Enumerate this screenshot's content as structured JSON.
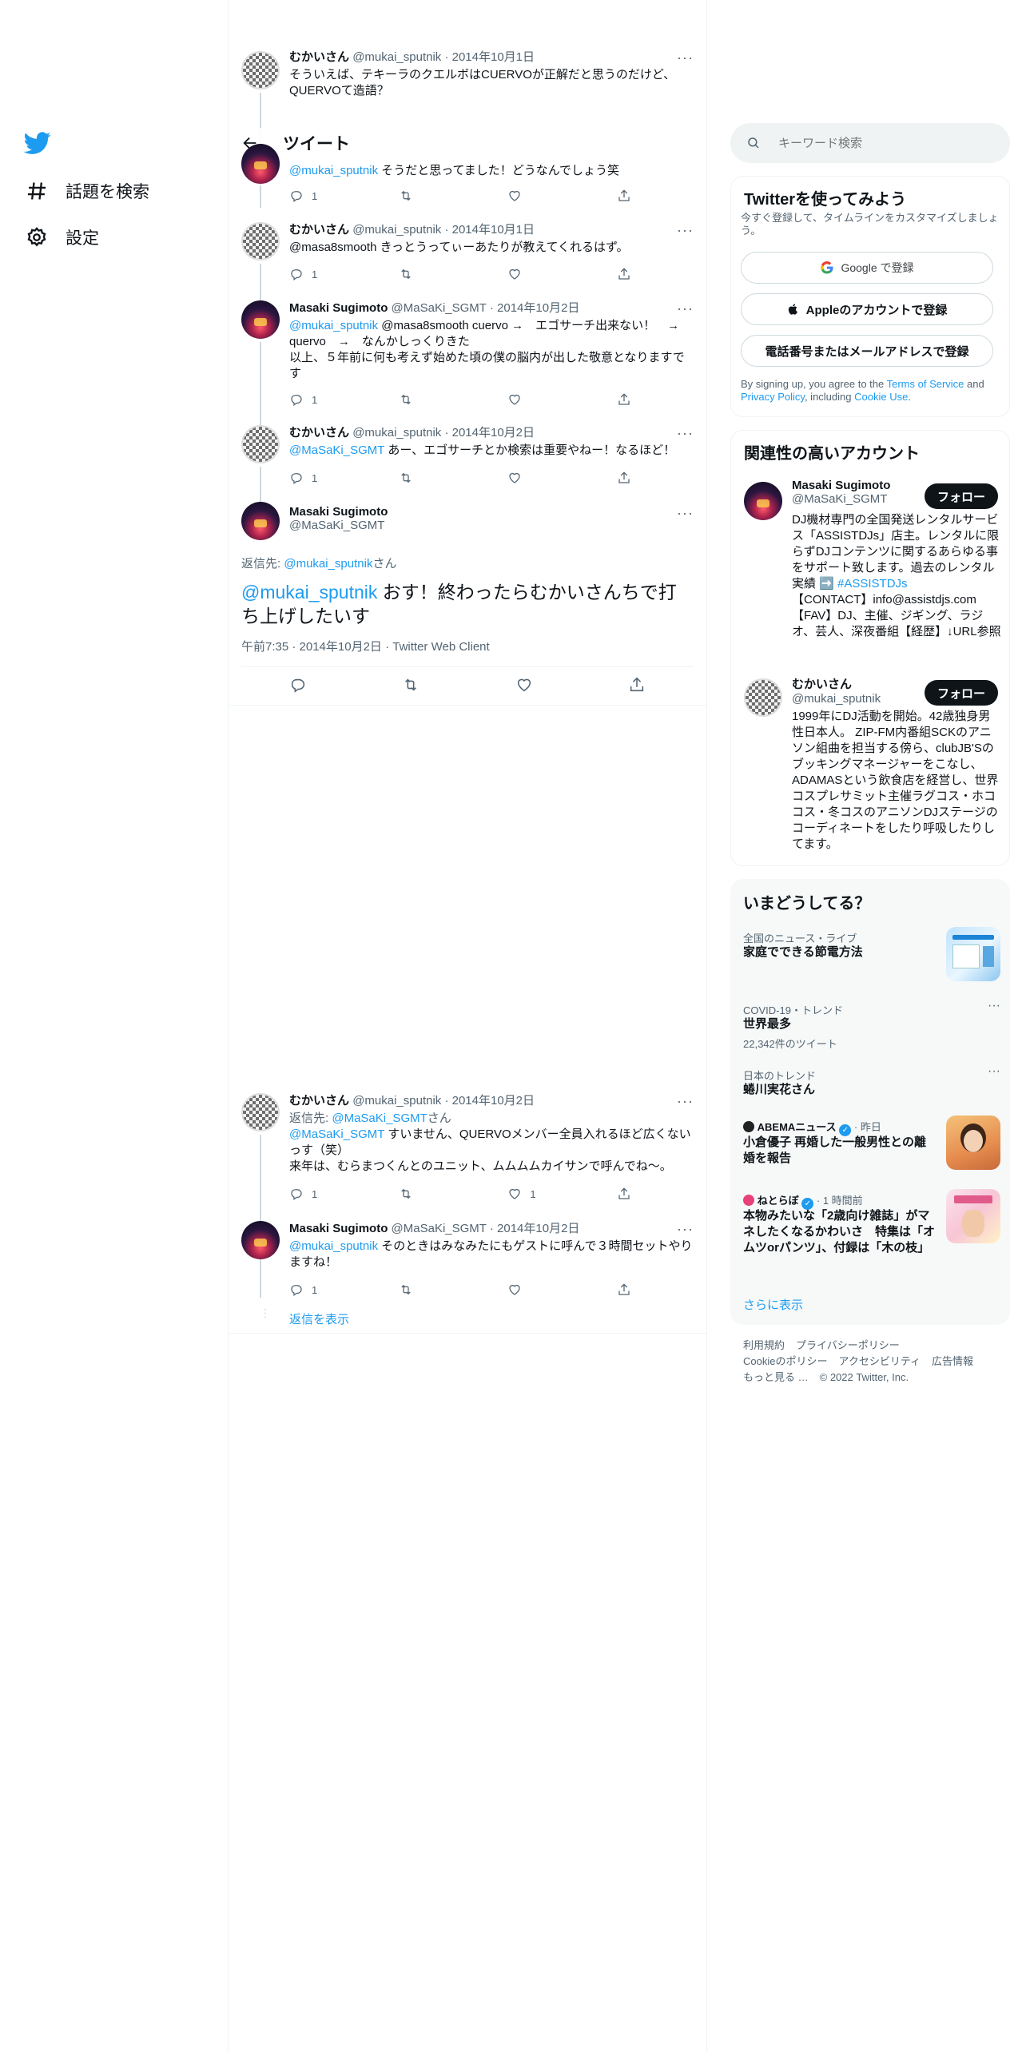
{
  "nav": {
    "explore_label": "話題を検索",
    "settings_label": "設定"
  },
  "header": {
    "title": "ツイート"
  },
  "thread_top": {
    "name": "むかいさん",
    "meta": "@mukai_sputnik · 2014年10月1日",
    "text": "そういえば、テキーラのクエルボはCUERVOが正解だと思うのだけど、QUERVOて造語？",
    "reply_count": "1"
  },
  "tweets": [
    {
      "name": "",
      "meta": "",
      "mention": "@mukai_sputnik",
      "text": " そうだと思ってました！どうなんでしょう笑",
      "reply_count": "1"
    },
    {
      "name": "むかいさん",
      "meta": "@mukai_sputnik · 2014年10月1日",
      "text": "@masa8smooth きっとうってぃーあたりが教えてくれるはず。",
      "reply_count": "1"
    },
    {
      "name": "Masaki Sugimoto",
      "meta": "@MaSaKi_SGMT · 2014年10月2日",
      "mention": "@mukai_sputnik",
      "text": " @masa8smooth cuervo →　エゴサーチ出来ない！　→ quervo　→　なんかしっくりきた\n以上、５年前に何も考えず始めた頃の僕の脳内が出した敬意となりますです",
      "reply_count": "1"
    },
    {
      "name": "むかいさん",
      "meta": "@mukai_sputnik · 2014年10月2日",
      "mention": "@MaSaKi_SGMT",
      "text": " あー、エゴサーチとか検索は重要やねー！なるほど！",
      "reply_count": "1"
    }
  ],
  "focus": {
    "name": "Masaki Sugimoto",
    "handle": "@MaSaKi_SGMT",
    "reply_prefix": "返信先: ",
    "reply_to": "@mukai_sputnik",
    "reply_suffix": "さん",
    "mention": "@mukai_sputnik",
    "text": " おす！終わったらむかいさんちで打ち上げしたいす",
    "meta": "午前7:35 · 2014年10月2日 · Twitter Web Client"
  },
  "replies": [
    {
      "name": "むかいさん",
      "meta": "@mukai_sputnik · 2014年10月2日",
      "reply_prefix": "返信先: ",
      "reply_to": "@MaSaKi_SGMT",
      "reply_suffix": "さん",
      "mention": "@MaSaKi_SGMT",
      "text": " すいません、QUERVOメンバー全員入れるほど広くないっす（笑）\n来年は、むらまつくんとのユニット、ムムムムカイサンで呼んでね〜。",
      "reply_count": "1",
      "like_count": "1"
    },
    {
      "name": "Masaki Sugimoto",
      "meta": "@MaSaKi_SGMT · 2014年10月2日",
      "mention": "@mukai_sputnik",
      "text": " そのときはみなみたにもゲストに呼んで３時間セットやりますね！",
      "reply_count": "1"
    }
  ],
  "show_replies": "返信を表示",
  "sidebar": {
    "search_placeholder": "キーワード検索",
    "signup": {
      "title": "Twitterを使ってみよう",
      "subtitle": "今すぐ登録して、タイムラインをカスタマイズしましょう。",
      "google": "Google で登録",
      "apple": "Appleのアカウントで登録",
      "phone": "電話番号またはメールアドレスで登録",
      "terms_prefix": "By signing up, you agree to the ",
      "terms_link": "Terms of Service",
      "terms_and": " and ",
      "privacy_link": "Privacy Policy",
      "terms_including": ", including ",
      "cookie_link": "Cookie Use",
      "terms_end": "."
    },
    "related": {
      "title": "関連性の高いアカウント",
      "follow_label": "フォロー",
      "accounts": [
        {
          "name": "Masaki Sugimoto",
          "handle": "@MaSaKi_SGMT",
          "bio": "DJ機材専門の全国発送レンタルサービス「ASSISTDJs」店主。レンタルに限らずDJコンテンツに関するあらゆる事をサポート致します。過去のレンタル実績 ➡️",
          "bio_tag": " #ASSISTDJs",
          "bio_rest": "【CONTACT】info@assistdjs.com 【FAV】DJ、主催、ジギング、ラジオ、芸人、深夜番組【経歴】↓URL参照"
        },
        {
          "name": "むかいさん",
          "handle": "@mukai_sputnik",
          "bio": "1999年にDJ活動を開始。42歳独身男性日本人。 ZIP-FM内番組SCKのアニソン組曲を担当する傍ら、clubJB'Sのブッキングマネージャーをこなし、ADAMASという飲食店を経営し、世界コスプレサミット主催ラグコス・ホココス・冬コスのアニソンDJステージのコーディネートをしたり呼吸したりしてます。"
        }
      ]
    },
    "trends": {
      "title": "いまどうしてる？",
      "items": [
        {
          "meta": "全国のニュース・ライブ",
          "title": "家庭でできる節電方法",
          "count": ""
        },
        {
          "meta": "COVID-19・トレンド",
          "title": "世界最多",
          "count": "22,342件のツイート"
        },
        {
          "meta": "日本のトレンド",
          "title": "蜷川実花さん",
          "count": ""
        },
        {
          "meta_source": "ABEMAニュース",
          "meta_time": " · 昨日",
          "title": "小倉優子 再婚した一般男性との離婚を報告"
        },
        {
          "meta_source": "ねとらぼ",
          "meta_time": " · 1 時間前",
          "title": "本物みたいな「2歳向け雑誌」がマネしたくなるかわいさ　特集は「オムツorパンツ」、付録は「木の枝」"
        }
      ],
      "show_more": "さらに表示"
    },
    "footer": {
      "links": [
        "利用規約",
        "プライバシーポリシー",
        "Cookieのポリシー",
        "アクセシビリティ",
        "広告情報",
        "もっと見る …"
      ],
      "copyright": "© 2022 Twitter, Inc."
    }
  }
}
